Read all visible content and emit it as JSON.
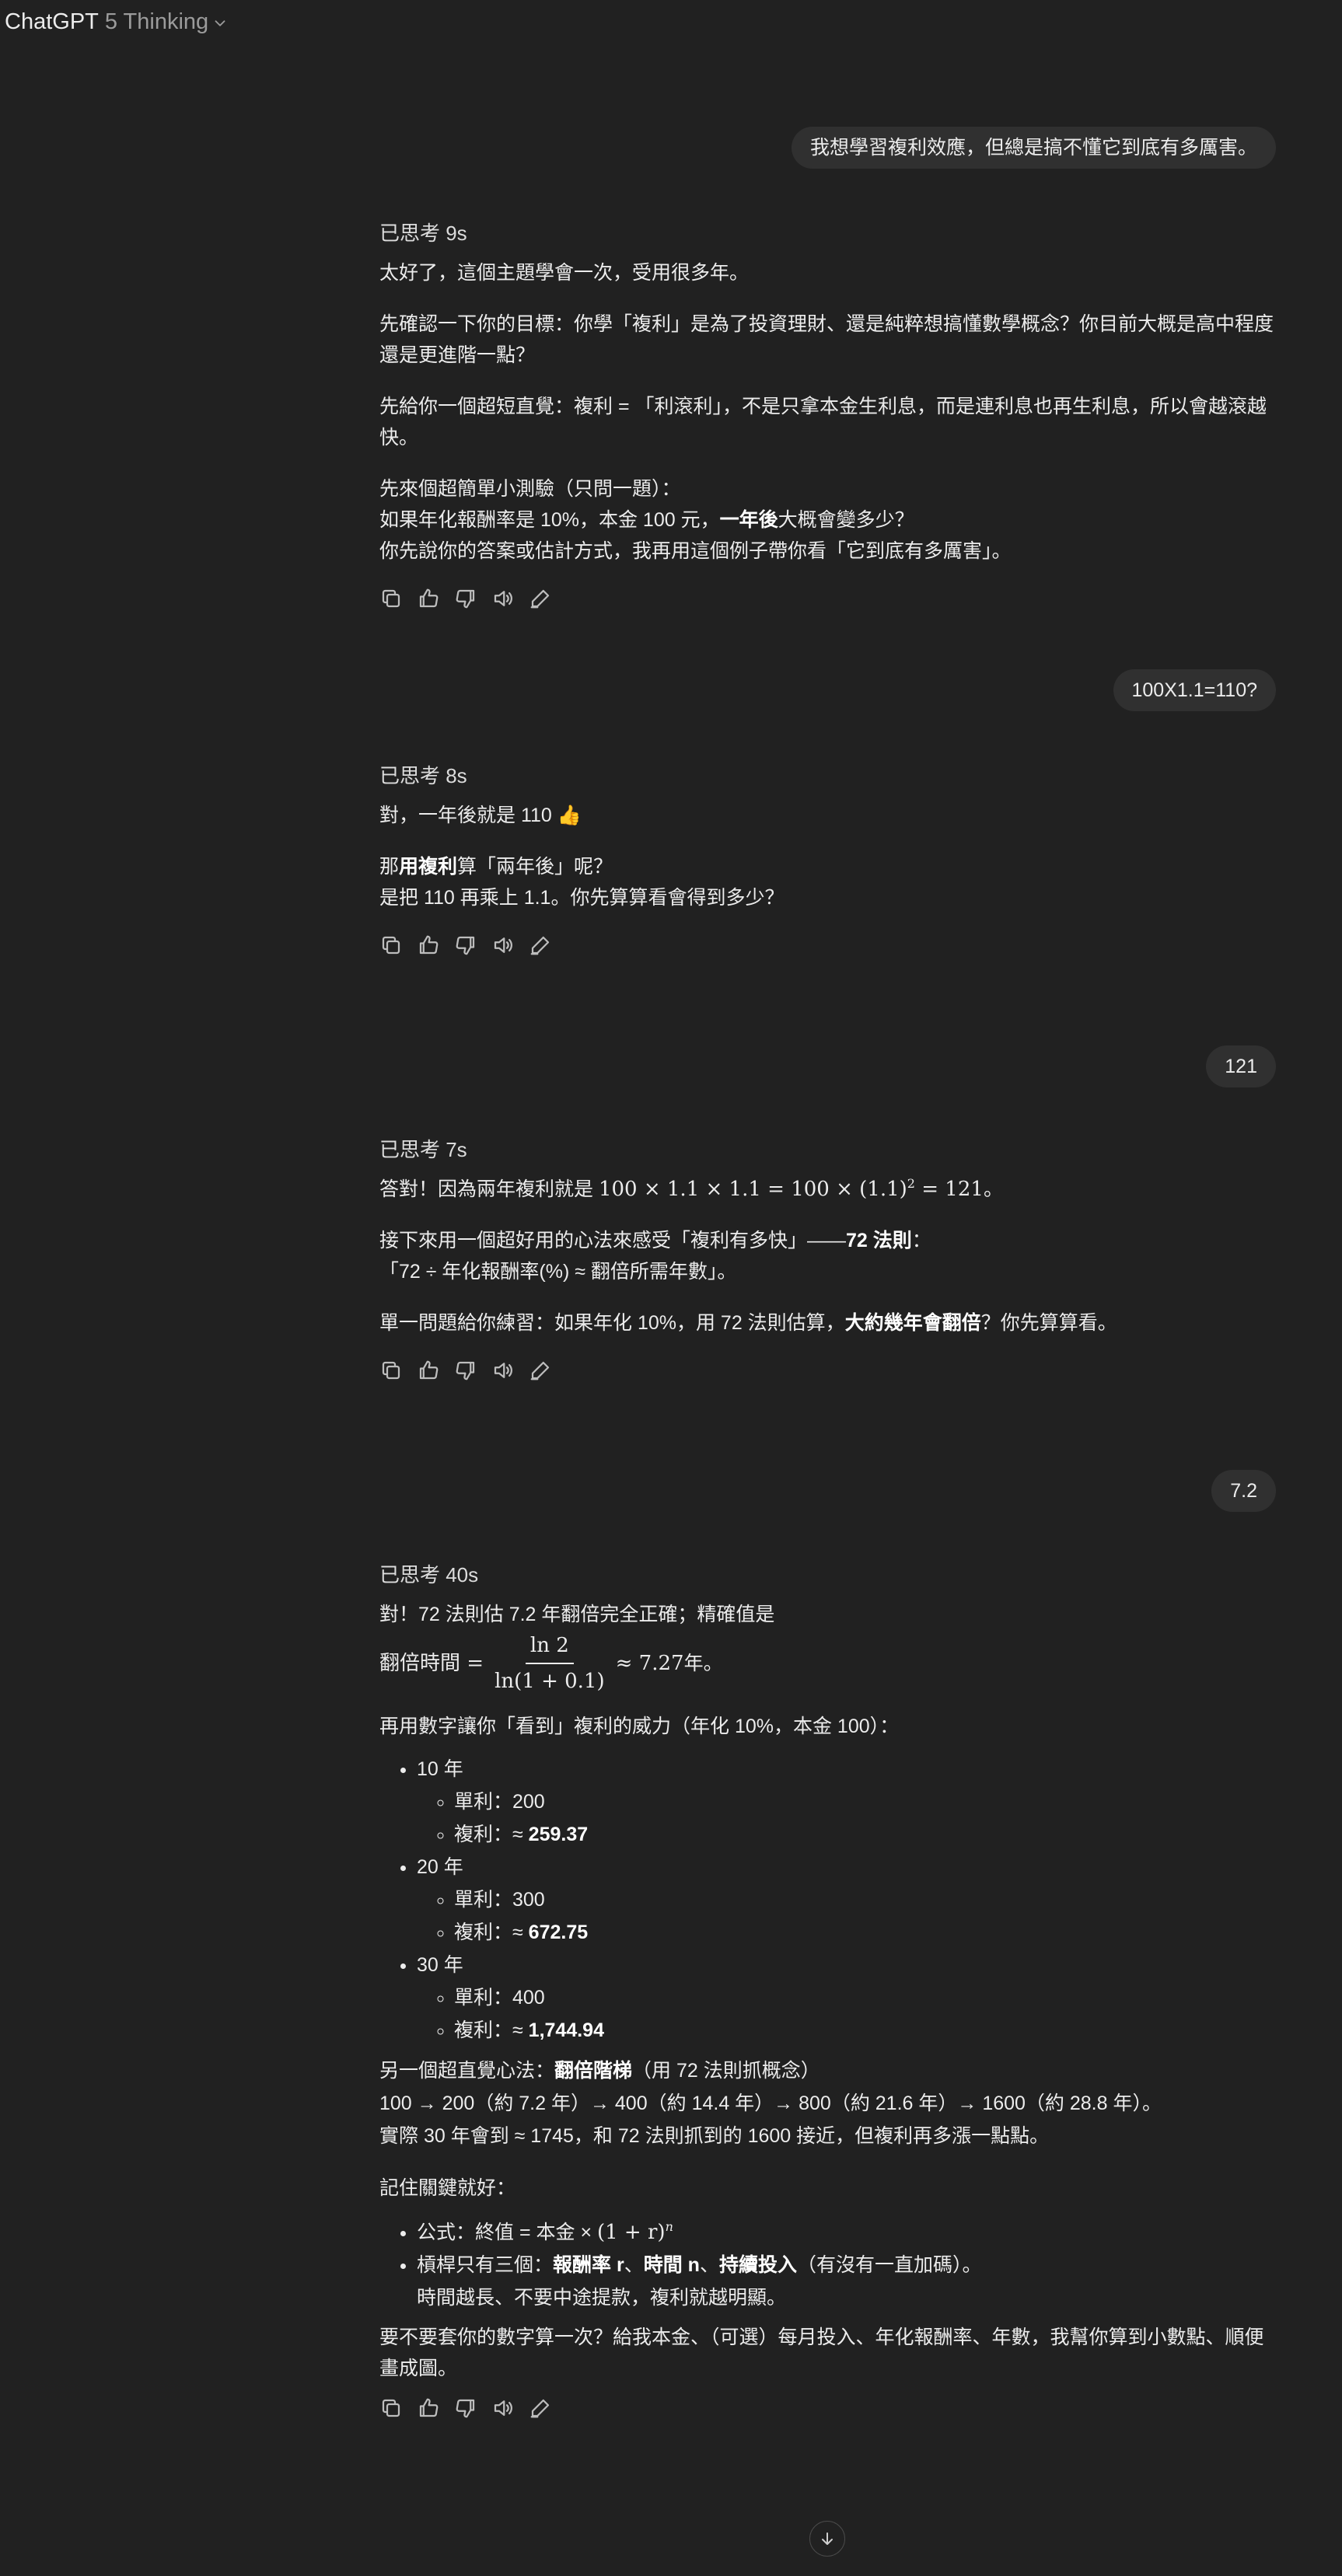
{
  "header": {
    "title": "ChatGPT",
    "model": "5 Thinking"
  },
  "turns": {
    "u1": "我想學習複利效應，但總是搞不懂它到底有多厲害。",
    "a1": {
      "thought": "已思考 9s",
      "p1": "太好了，這個主題學會一次，受用很多年。",
      "p2": "先確認一下你的目標：你學「複利」是為了投資理財、還是純粹想搞懂數學概念？你目前大概是高中程度還是更進階一點？",
      "p3": "先給你一個超短直覺：複利 = 「利滾利」，不是只拿本金生利息，而是連利息也再生利息，所以會越滾越快。",
      "p4_l1": "先來個超簡單小測驗（只問一題）：",
      "p4_l2a": "如果年化報酬率是 10%，本金 100 元，",
      "p4_l2b": "一年後",
      "p4_l2c": "大概會變多少？",
      "p4_l3": "你先說你的答案或估計方式，我再用這個例子帶你看「它到底有多厲害」。"
    },
    "u2": "100X1.1=110?",
    "a2": {
      "thought": "已思考 8s",
      "p1": "對，一年後就是 110 👍",
      "p2a": "那",
      "p2b": "用複利",
      "p2c": "算「兩年後」呢？",
      "p2_l2": "是把 110 再乘上 1.1。你先算算看會得到多少？"
    },
    "u3": "121",
    "a3": {
      "thought": "已思考 7s",
      "p1a": "答對！因為兩年複利就是 ",
      "p1_math": "100 × 1.1 × 1.1 = 100 × (1.1)",
      "p1_sup": "2",
      "p1_math2": " = 121",
      "p1_end": "。",
      "p2a": "接下來用一個超好用的心法來感受「複利有多快」——",
      "p2b": "72 法則",
      "p2c": "：",
      "p2_l2": "「72 ÷ 年化報酬率(%) ≈ 翻倍所需年數」。",
      "p3a": "單一問題給你練習：如果年化 10%，用 72 法則估算，",
      "p3b": "大約幾年會翻倍",
      "p3c": "？你先算算看。"
    },
    "u4": "7.2",
    "a4": {
      "thought": "已思考 40s",
      "p1": "對！72 法則估 7.2 年翻倍完全正確；精確值是",
      "f_lhs": "翻倍時間 =",
      "f_num": "ln 2",
      "f_den": "ln(1 + 0.1)",
      "f_rhs": "≈ 7.27",
      "f_unit": " 年。",
      "p2": "再用數字讓你「看到」複利的威力（年化 10%，本金 100）：",
      "list": [
        {
          "label": "10 年",
          "simple": "單利：200",
          "compound_pre": "複利：≈ ",
          "compound": "259.37"
        },
        {
          "label": "20 年",
          "simple": "單利：300",
          "compound_pre": "複利：≈ ",
          "compound": "672.75"
        },
        {
          "label": "30 年",
          "simple": "單利：400",
          "compound_pre": "複利：≈ ",
          "compound": "1,744.94"
        }
      ],
      "p3a": "另一個超直覺心法：",
      "p3b": "翻倍階梯",
      "p3c": "（用 72 法則抓概念）",
      "p3_l2": "100 → 200（約 7.2 年）→ 400（約 14.4 年）→ 800（約 21.6 年）→ 1600（約 28.8 年）。",
      "p3_l3": "實際 30 年會到 ≈ 1745，和 72 法則抓到的 1600 接近，但複利再多漲一點點。",
      "p4": "記住關鍵就好：",
      "b1a": "公式：終值 = 本金 × ",
      "b1_math": "(1 + r)",
      "b1_sup": "n",
      "b2a": "槓桿只有三個：",
      "b2b": "報酬率 r",
      "b2c": "、",
      "b2d": "時間 n",
      "b2e": "、",
      "b2f": "持續投入",
      "b2g": "（有沒有一直加碼）。",
      "b2_l2": "時間越長、不要中途提款，複利就越明顯。",
      "p5": "要不要套你的數字算一次？給我本金、（可選）每月投入、年化報酬率、年數，我幫你算到小數點、順便畫成圖。"
    }
  },
  "icons": [
    "copy-icon",
    "thumbs-up-icon",
    "thumbs-down-icon",
    "read-aloud-icon",
    "edit-icon",
    "arrow-down-icon",
    "chevron-down-icon"
  ]
}
